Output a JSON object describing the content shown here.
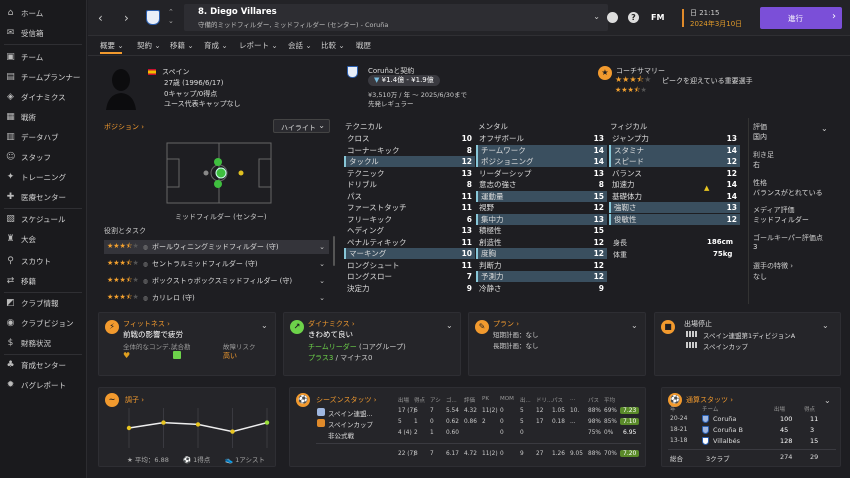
{
  "sidebar": {
    "items": [
      {
        "label": "ホーム",
        "icon": "home-icon"
      },
      {
        "label": "受信箱",
        "icon": "inbox-icon"
      },
      {
        "label": "チーム",
        "icon": "shirt-icon"
      },
      {
        "label": "チームプランナー",
        "icon": "planner-icon"
      },
      {
        "label": "ダイナミクス",
        "icon": "dynamics-icon"
      },
      {
        "label": "戦術",
        "icon": "tactics-icon"
      },
      {
        "label": "データハブ",
        "icon": "datahub-icon"
      },
      {
        "label": "スタッフ",
        "icon": "staff-icon"
      },
      {
        "label": "トレーニング",
        "icon": "training-icon"
      },
      {
        "label": "医療センター",
        "icon": "medical-icon"
      },
      {
        "label": "スケジュール",
        "icon": "calendar-icon"
      },
      {
        "label": "大会",
        "icon": "trophy-icon"
      },
      {
        "label": "スカウト",
        "icon": "scout-icon"
      },
      {
        "label": "移籍",
        "icon": "transfer-icon"
      },
      {
        "label": "クラブ情報",
        "icon": "club-info-icon"
      },
      {
        "label": "クラブビジョン",
        "icon": "vision-icon"
      },
      {
        "label": "財務状況",
        "icon": "finance-icon"
      },
      {
        "label": "育成センター",
        "icon": "youth-icon"
      },
      {
        "label": "バグレポート",
        "icon": "bug-icon"
      }
    ]
  },
  "header": {
    "player_name": "8. Diego Villares",
    "subtitle": "守備的ミッドフィルダー, ミッドフィルダー (センター) - Coruña",
    "fm_label": "FM",
    "time": "日 21:15",
    "date": "2024年3月10日",
    "continue_label": "進行"
  },
  "tabs": [
    "概要",
    "契約",
    "移籍",
    "育成",
    "レポート",
    "会話",
    "比較",
    "戦歴"
  ],
  "profile": {
    "nationality": "スペイン",
    "age": "27歳 (1996/6/17)",
    "caps": "0キャップ/0得点",
    "youth_caps": "ユース代表キャップなし"
  },
  "contract": {
    "title": "Coruñaと契約",
    "value": "¥1.4億 - ¥1.9億",
    "wage": "¥3,510万 / 年 〜 2025/6/30まで",
    "status": "先発レギュラー"
  },
  "coach": {
    "title": "コーチサマリー",
    "summary": "ピークを迎えている重要選手",
    "stars_current": 3.5,
    "stars_potential": 3.5
  },
  "position": {
    "title": "ポジション",
    "dropdown": "ハイライト",
    "label": "ミッドフィルダー (センター)",
    "roles_title": "役割とタスク",
    "roles": [
      {
        "stars": 3.5,
        "label": "ボールウィニングミッドフィルダー (守)"
      },
      {
        "stars": 3.5,
        "label": "セントラルミッドフィルダー (守)"
      },
      {
        "stars": 3.5,
        "label": "ボックストゥボックスミッドフィルダー (守)"
      },
      {
        "stars": 3.5,
        "label": "カリレロ (守)"
      }
    ]
  },
  "attributes": {
    "technical_title": "テクニカル",
    "mental_title": "メンタル",
    "physical_title": "フィジカル",
    "technical": [
      {
        "n": "クロス",
        "v": "10",
        "hl": false
      },
      {
        "n": "コーナーキック",
        "v": "8",
        "hl": false
      },
      {
        "n": "タックル",
        "v": "12",
        "hl": true
      },
      {
        "n": "テクニック",
        "v": "13",
        "hl": false
      },
      {
        "n": "ドリブル",
        "v": "8",
        "hl": false
      },
      {
        "n": "パス",
        "v": "11",
        "hl": false
      },
      {
        "n": "ファーストタッチ",
        "v": "11",
        "hl": false
      },
      {
        "n": "フリーキック",
        "v": "6",
        "hl": false
      },
      {
        "n": "ヘディング",
        "v": "13",
        "hl": false
      },
      {
        "n": "ペナルティキック",
        "v": "11",
        "hl": false
      },
      {
        "n": "マーキング",
        "v": "10",
        "hl": true
      },
      {
        "n": "ロングシュート",
        "v": "11",
        "hl": false
      },
      {
        "n": "ロングスロー",
        "v": "7",
        "hl": false
      },
      {
        "n": "決定力",
        "v": "9",
        "hl": false
      }
    ],
    "mental": [
      {
        "n": "オフザボール",
        "v": "13",
        "hl": false
      },
      {
        "n": "チームワーク",
        "v": "14",
        "hl": true
      },
      {
        "n": "ポジショニング",
        "v": "14",
        "hl": true
      },
      {
        "n": "リーダーシップ",
        "v": "13",
        "hl": false
      },
      {
        "n": "意志の強さ",
        "v": "8",
        "hl": false
      },
      {
        "n": "運動量",
        "v": "15",
        "hl": true
      },
      {
        "n": "視野",
        "v": "12",
        "hl": false
      },
      {
        "n": "集中力",
        "v": "13",
        "hl": true
      },
      {
        "n": "積極性",
        "v": "15",
        "hl": false
      },
      {
        "n": "創造性",
        "v": "12",
        "hl": false
      },
      {
        "n": "度胸",
        "v": "12",
        "hl": true
      },
      {
        "n": "判断力",
        "v": "12",
        "hl": false
      },
      {
        "n": "予測力",
        "v": "12",
        "hl": true
      },
      {
        "n": "冷静さ",
        "v": "9",
        "hl": false
      }
    ],
    "physical": [
      {
        "n": "ジャンプ力",
        "v": "13",
        "hl": false
      },
      {
        "n": "スタミナ",
        "v": "14",
        "hl": true
      },
      {
        "n": "スピード",
        "v": "12",
        "hl": true
      },
      {
        "n": "バランス",
        "v": "12",
        "hl": false
      },
      {
        "n": "加速力",
        "v": "14",
        "hl": false
      },
      {
        "n": "基礎体力",
        "v": "14",
        "hl": false
      },
      {
        "n": "強靭さ",
        "v": "13",
        "hl": true
      },
      {
        "n": "俊敏性",
        "v": "12",
        "hl": true
      }
    ],
    "height_label": "身長",
    "height": "186cm",
    "weight_label": "体重",
    "weight": "75kg"
  },
  "info": {
    "rating_label": "評価",
    "rating_value": "国内",
    "foot_label": "利き足",
    "foot_value": "右",
    "personality_label": "性格",
    "personality_value": "バランスがとれている",
    "media_label": "メディア評価",
    "media_value": "ミッドフィルダー",
    "gk_label": "ゴールキーパー評価点",
    "gk_value": "3",
    "traits_label": "選手の特徴",
    "traits_value": "なし"
  },
  "fitness": {
    "title": "フィットネス",
    "status": "前戦の影響で疲労",
    "cond_label": "全体的なコンデ...",
    "match_label": "試合勘",
    "injury_label": "故障リスク",
    "injury_value": "高い"
  },
  "dynamics": {
    "title": "ダイナミクス",
    "status": "きわめて良い",
    "leader": "チームリーダー",
    "leader_group": "(コアグループ)",
    "plus": "プラス3",
    "minus": "/ マイナス0"
  },
  "plan": {
    "title": "プラン",
    "short": "短期計画：なし",
    "long": "長期計画：なし"
  },
  "suspension": {
    "title": "出場停止",
    "comp1": "スペイン連盟第1ディビジョンA",
    "comp2": "スペインカップ"
  },
  "form": {
    "title": "調子",
    "avg": "平均：6.88",
    "goals": "1得点",
    "assists": "1アシスト",
    "points": [
      7.0,
      7.3,
      7.2,
      6.8,
      7.3
    ]
  },
  "season": {
    "title": "シーズンスタッツ",
    "headers": [
      "出場",
      "得点",
      "アシ",
      "ゴ...",
      "評価",
      "PK",
      "MOM",
      "出...",
      "ドリ...",
      "パス",
      "...",
      "パス",
      "平均"
    ],
    "rows": [
      {
        "comp": "スペイン連盟...",
        "cells": [
          "17 (7)",
          "6",
          "7",
          "5.54",
          "4.32",
          "11(2)",
          "0",
          "5",
          "12",
          "1.05",
          "10.",
          "88%",
          "69%",
          "4"
        ],
        "rating": "7.23"
      },
      {
        "comp": "スペインカップ",
        "cells": [
          "5",
          "1",
          "0",
          "0.62",
          "0.86",
          "2",
          "0",
          "5",
          "17",
          "0.18",
          "...",
          "98%",
          "85%",
          "4"
        ],
        "rating": "7.10"
      },
      {
        "comp": "非公式戦",
        "cells": [
          "4 (4)",
          "2",
          "1",
          "0.60",
          "",
          "",
          "0",
          "0",
          "",
          "",
          "",
          "75%",
          "0%",
          "1"
        ],
        "rating": "6.95"
      }
    ],
    "total": {
      "cells": [
        "22 (7)",
        "8",
        "7",
        "6.17",
        "4.72",
        "11(2)",
        "0",
        "9",
        "27",
        "1.26",
        "9.05",
        "88%",
        "70%",
        "4"
      ],
      "rating": "7.20"
    }
  },
  "career": {
    "title": "通算スタッツ",
    "headers": [
      "年",
      "チーム",
      "出場",
      "得点"
    ],
    "rows": [
      {
        "years": "20-24",
        "team": "Coruña",
        "apps": "100",
        "goals": "11"
      },
      {
        "years": "18-21",
        "team": "Coruña B",
        "apps": "45",
        "goals": "3"
      },
      {
        "years": "13-18",
        "team": "Villalbés",
        "apps": "128",
        "goals": "15"
      }
    ],
    "total_label": "総合",
    "total_teams": "3クラブ",
    "total_apps": "274",
    "total_goals": "29"
  },
  "colors": {
    "accent": "#7b4fd8",
    "orange": "#f29a2e",
    "highlight": "#3a4f5f"
  }
}
